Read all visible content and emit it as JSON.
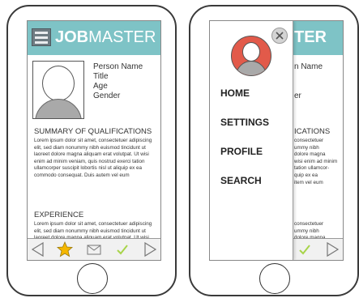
{
  "app": {
    "title_bold": "JOB",
    "title_light": "MASTER",
    "title_right": "TER"
  },
  "profile": {
    "name": "Person Name",
    "title": "Title",
    "age": "Age",
    "gender": "Gender",
    "name_partial": "n Name",
    "gender_partial": "er"
  },
  "sections": {
    "qualifications_title": "SUMMARY OF QUALIFICATIONS",
    "qualifications_text": "Lorem ipsum dolor sit amet, consectetuer adipiscing elit, sed diam nonummy nibh euismod tincidunt ut laoreet dolore magna aliquam erat volutpat. Ut wisi enim ad minim veniam, quis nostrud exerci tation ullamcorper suscipit lobortis nisl ut aliquip ex ea commodo consequat. Duis autem vel eum",
    "experience_title": "EXPERIENCE",
    "experience_text": "Lorem ipsum dolor sit amet, consectetuer adipiscing elit, sed diam nonummy nibh euismod tincidunt ut laoreet dolore magna aliquam erat volutpat. Ut wisi enim ad minim",
    "qualifications_title_partial": "ICATIONS",
    "qualifications_text_partial": "consectetuer\nummy nibh\ndolore magna\nwisi enim ad minim\ntation ullamcor-\nquip ex ea\nitem vel eum",
    "experience_text_partial": "consectetuer\nummy nibh\ndolore magna\nenim ad minim"
  },
  "drawer": {
    "items": [
      "HOME",
      "SETTINGS",
      "PROFILE",
      "SEARCH"
    ]
  },
  "bottom_bar": {
    "icons": [
      "back-arrow-icon",
      "star-icon",
      "mail-icon",
      "checkmark-icon",
      "forward-arrow-icon"
    ]
  },
  "colors": {
    "header": "#7ec3c6",
    "star": "#f5b700",
    "check": "#a8d44a",
    "drawer_avatar": "#e25a4a"
  }
}
